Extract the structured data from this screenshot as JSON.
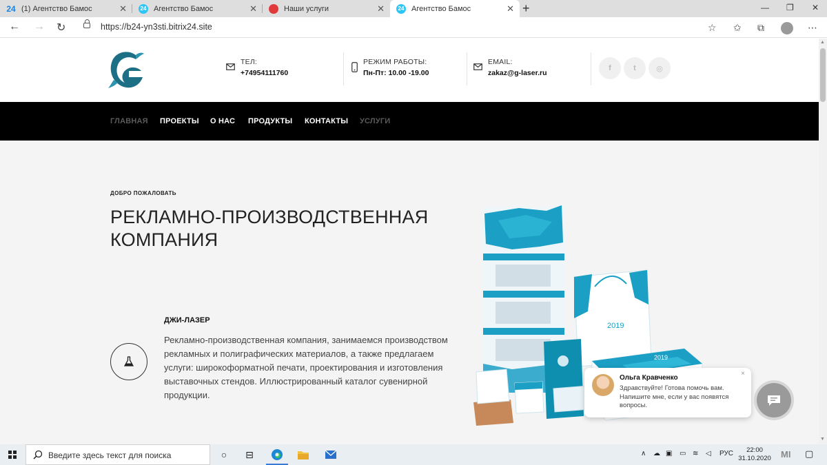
{
  "browser": {
    "tabs": [
      {
        "title": "(1) Агентство Бамос",
        "favicon": "bitrix24-text-icon",
        "favicon_text": "24"
      },
      {
        "title": "Агентство Бамос",
        "favicon": "bitrix24-circle-icon",
        "favicon_text": "24"
      },
      {
        "title": "Наши услуги",
        "favicon": "red-circle-icon",
        "favicon_text": ""
      },
      {
        "title": "Агентство Бамос",
        "favicon": "bitrix24-circle-icon",
        "favicon_text": "24",
        "active": true
      }
    ],
    "url": "https://b24-yn3sti.bitrix24.site"
  },
  "header": {
    "phone": {
      "label": "ТЕЛ:",
      "value": "+74954111760",
      "icon": "envelope-icon"
    },
    "hours": {
      "label": "РЕЖИМ РАБОТЫ:",
      "value": "Пн-Пт: 10.00 -19.00",
      "icon": "mobile-icon"
    },
    "email": {
      "label": "EMAIL:",
      "value": "zakaz@g-laser.ru",
      "icon": "envelope-icon"
    },
    "social": [
      {
        "name": "facebook-icon",
        "glyph": "f"
      },
      {
        "name": "twitter-icon",
        "glyph": "t"
      },
      {
        "name": "instagram-icon",
        "glyph": "◎"
      }
    ]
  },
  "nav": {
    "items": [
      {
        "label": "ГЛАВНАЯ",
        "muted": true
      },
      {
        "label": "ПРОЕКТЫ",
        "muted": false
      },
      {
        "label": "О НАС",
        "muted": false
      },
      {
        "label": "ПРОДУКТЫ",
        "muted": false
      },
      {
        "label": "КОНТАКТЫ",
        "muted": false
      },
      {
        "label": "УСЛУГИ",
        "muted": true
      }
    ]
  },
  "hero": {
    "welcome": "ДОБРО ПОЖАЛОВАТЬ",
    "title": "РЕКЛАМНО-ПРОИЗВОДСТВЕННАЯ КОМПАНИЯ",
    "company": "ДЖИ-ЛАЗЕР",
    "description": "Рекламно-производственная компания, занимаемся производством рекламных и полиграфических материалов, а также предлагаем услуги: широкоформатной печати, проектирования и изготовления выставочных стендов. Иллюстрированный каталог сувенирной продукции.",
    "feature_icon": "flask-icon",
    "product_year": "2019"
  },
  "chat": {
    "name": "Ольга Кравченко",
    "message": "Здравствуйте! Готова помочь вам. Напишите мне, если у вас появятся вопросы.",
    "close": "×"
  },
  "taskbar": {
    "search_placeholder": "Введите здесь текст для поиска",
    "language": "РУС",
    "time": "22:00",
    "date": "31.10.2020"
  },
  "colors": {
    "accent_teal": "#1b9fc4",
    "logo_dark": "#1d6f86",
    "nav_bg": "#000000",
    "page_bg": "#f4f4f4"
  }
}
